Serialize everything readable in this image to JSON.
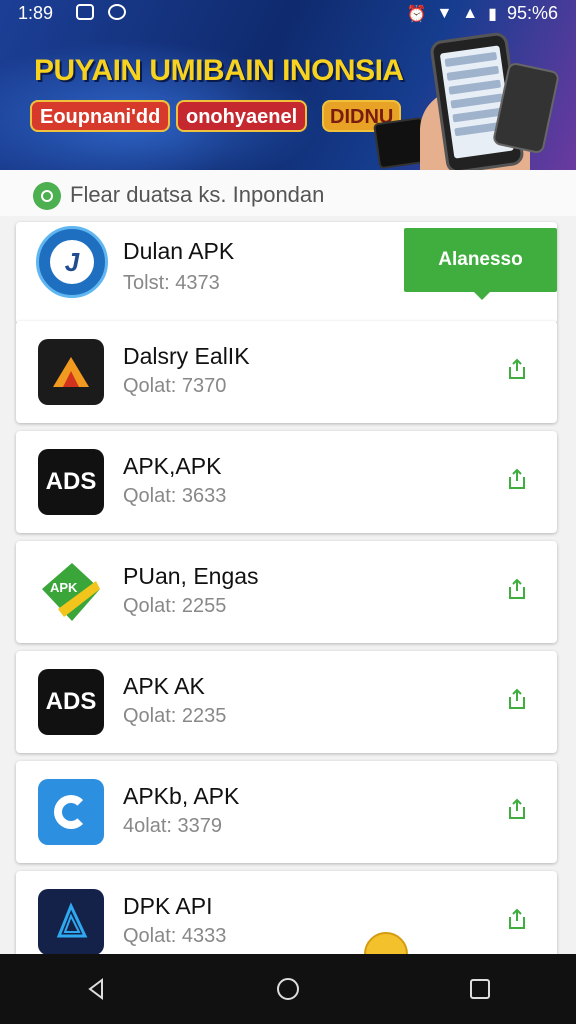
{
  "status_bar": {
    "time": "1:89",
    "battery": "95:%6"
  },
  "banner": {
    "headline": "PUYAIN UMIBAIN INONSIA",
    "pill1": "Eoupnani'dd",
    "pill2": "onohyaenel",
    "pill3": "DIDNU"
  },
  "search": {
    "text": "Flear duatsa ks. Inpondan"
  },
  "apps": [
    {
      "title": "Dulan APK",
      "subtitle": "Tolst: 4373",
      "icon": "blue-circle-app-icon",
      "action": "Alanesso"
    },
    {
      "title": "Dalsry EalIK",
      "subtitle": "Qolat: 7370",
      "icon": "orange-triangle-app-icon"
    },
    {
      "title": "APK,APK",
      "subtitle": "Qolat: 3633",
      "icon": "black-ads-app-icon"
    },
    {
      "title": "PUan, Engas",
      "subtitle": "Qolat: 2255",
      "icon": "green-apk-app-icon"
    },
    {
      "title": "APK AK",
      "subtitle": "Qolat: 2235",
      "icon": "black-ads-red-app-icon"
    },
    {
      "title": "APKb, APK",
      "subtitle": "4olat: 3379",
      "icon": "blue-c-app-icon"
    },
    {
      "title": "DPK API",
      "subtitle": "Qolat: 4333",
      "icon": "navy-triangle-app-icon"
    }
  ],
  "colors": {
    "accent_green": "#3fae3f",
    "banner_blue": "#1c3f96",
    "headline_yellow": "#f7d21e"
  }
}
